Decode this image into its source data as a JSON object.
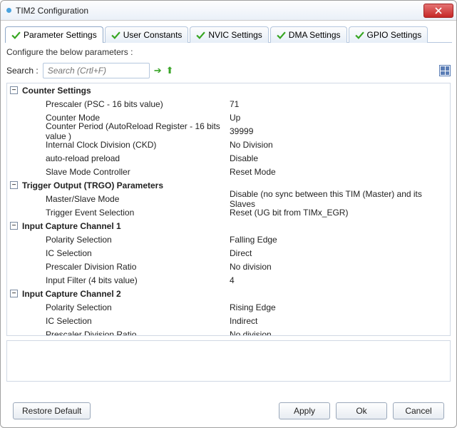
{
  "window": {
    "title": "TIM2 Configuration"
  },
  "tabs": {
    "parameter": "Parameter Settings",
    "user": "User Constants",
    "nvic": "NVIC Settings",
    "dma": "DMA Settings",
    "gpio": "GPIO Settings"
  },
  "hint": "Configure the below parameters :",
  "search": {
    "label": "Search :",
    "placeholder": "Search (Crtl+F)"
  },
  "sections": {
    "counter": {
      "title": "Counter Settings",
      "rows": [
        {
          "label": "Prescaler (PSC - 16 bits value)",
          "value": "71"
        },
        {
          "label": "Counter Mode",
          "value": "Up"
        },
        {
          "label": "Counter Period (AutoReload Register - 16 bits value )",
          "value": "39999"
        },
        {
          "label": "Internal Clock Division (CKD)",
          "value": "No Division"
        },
        {
          "label": "auto-reload preload",
          "value": "Disable"
        },
        {
          "label": "Slave Mode Controller",
          "value": "Reset Mode"
        }
      ]
    },
    "trgo": {
      "title": "Trigger Output (TRGO) Parameters",
      "rows": [
        {
          "label": "Master/Slave Mode",
          "value": "Disable (no sync between this TIM (Master) and its Slaves"
        },
        {
          "label": "Trigger Event Selection",
          "value": "Reset (UG bit from TIMx_EGR)"
        }
      ]
    },
    "ic1": {
      "title": "Input Capture Channel 1",
      "rows": [
        {
          "label": "Polarity Selection",
          "value": "Falling Edge"
        },
        {
          "label": "IC Selection",
          "value": "Direct"
        },
        {
          "label": "Prescaler Division Ratio",
          "value": "No division"
        },
        {
          "label": "Input Filter (4 bits value)",
          "value": "4"
        }
      ]
    },
    "ic2": {
      "title": "Input Capture Channel 2",
      "rows": [
        {
          "label": "Polarity Selection",
          "value": "Rising Edge"
        },
        {
          "label": "IC Selection",
          "value": "Indirect"
        },
        {
          "label": "Prescaler Division Ratio",
          "value": "No division"
        }
      ]
    }
  },
  "buttons": {
    "restore": "Restore Default",
    "apply": "Apply",
    "ok": "Ok",
    "cancel": "Cancel"
  }
}
